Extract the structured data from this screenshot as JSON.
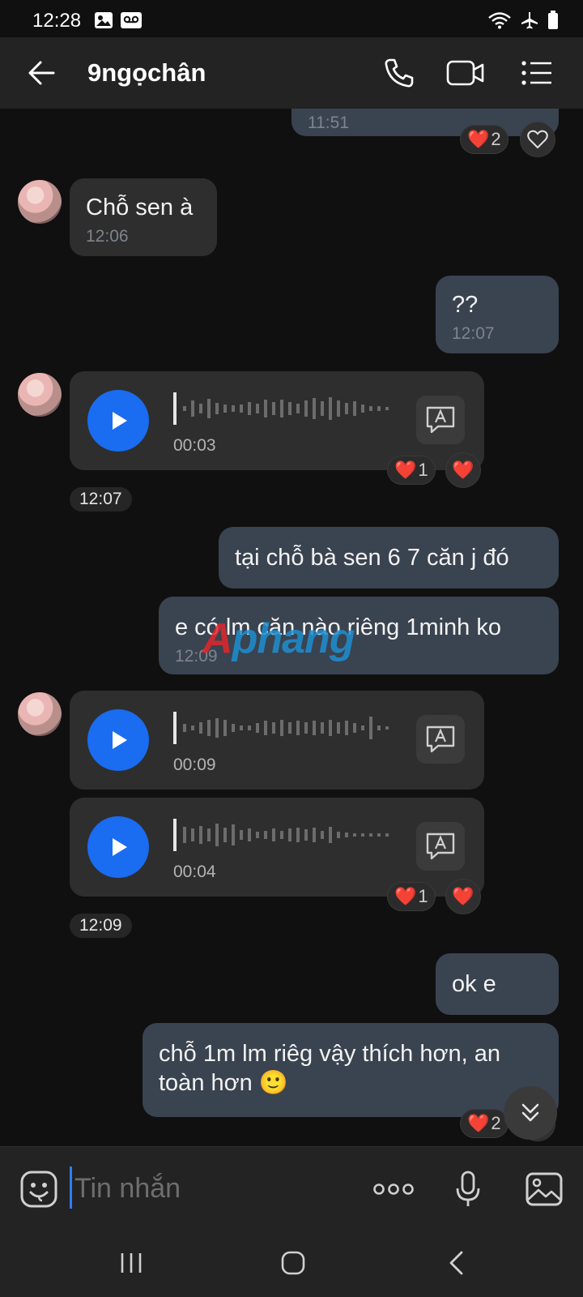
{
  "status": {
    "time": "12:28"
  },
  "header": {
    "contact_name": "9ngọchân"
  },
  "messages": [
    {
      "time": "11:51",
      "reaction_count": "2"
    },
    {
      "text": "Chỗ sen à",
      "time": "12:06"
    },
    {
      "text": "??",
      "time": "12:07"
    },
    {
      "duration": "00:03",
      "reaction_count": "1"
    },
    {
      "time_chip": "12:07"
    },
    {
      "text": "tại chỗ bà sen 6 7 căn j đó"
    },
    {
      "text": "e có lm căn nào riêng 1minh ko",
      "time": "12:09"
    },
    {
      "duration": "00:09"
    },
    {
      "duration": "00:04",
      "reaction_count": "1"
    },
    {
      "time_chip": "12:09"
    },
    {
      "text": "ok e"
    },
    {
      "text": "chỗ 1m lm riêg vậy thích hơn, an toàn hơn 🙂",
      "reaction_count": "2"
    }
  ],
  "watermark": {
    "part1": "A",
    "part2": "phang"
  },
  "composer": {
    "placeholder": "Tin nhắn"
  },
  "colors": {
    "accent_blue": "#1a6cf0",
    "heart_red": "#e8243a",
    "bubble_out": "#3a4350",
    "bubble_in": "#2e2e2e"
  }
}
